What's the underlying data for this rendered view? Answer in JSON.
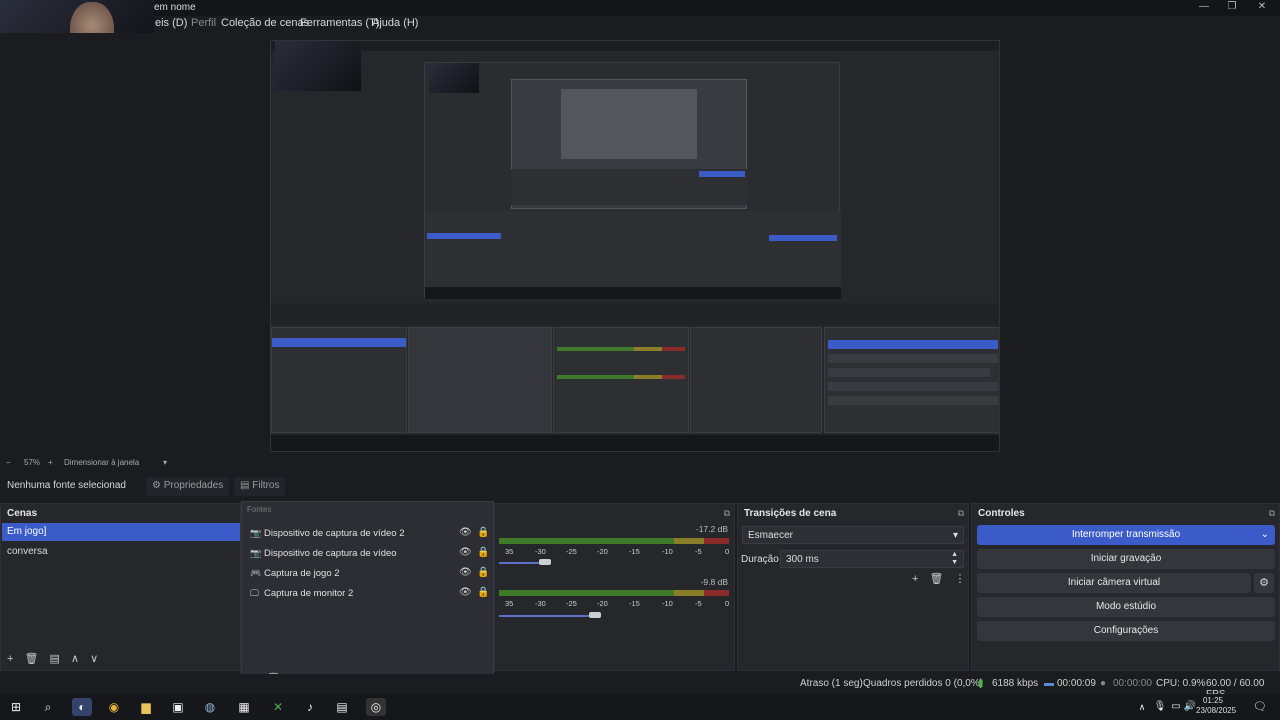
{
  "window": {
    "title": "em nome",
    "controls": [
      "—",
      "❐",
      "✕"
    ]
  },
  "menu": {
    "items": [
      {
        "label": "eis (D)",
        "dim": false
      },
      {
        "label": "Perfil",
        "dim": true
      },
      {
        "label": "Coleção de cenas",
        "dim": false
      },
      {
        "label": "Ferramentas (T)",
        "dim": false
      },
      {
        "label": "Ajuda (H)",
        "dim": false
      }
    ]
  },
  "zoom": {
    "minus": "−",
    "level": "57%",
    "plus": "+",
    "label": "Dimensionar à janela",
    "arrow": "▾"
  },
  "source_bar": {
    "no_source": "Nenhuma fonte selecionad",
    "properties": "Propriedades",
    "filters": "Filtros"
  },
  "scenes": {
    "title": "Cenas",
    "items": [
      {
        "label": "Em jogo]",
        "active": true
      },
      {
        "label": "conversa",
        "active": false
      }
    ],
    "toolbar": [
      "+",
      "🗑",
      "▤",
      "∧",
      "∨"
    ]
  },
  "sources": {
    "title": "Fontes",
    "items": [
      {
        "icon": "📷",
        "label": "Dispositivo de captura de vídeo 2"
      },
      {
        "icon": "📷",
        "label": "Dispositivo de captura de vídeo"
      },
      {
        "icon": "🎮",
        "label": "Captura de jogo 2"
      },
      {
        "icon": "🖵",
        "label": "Captura de monitor 2"
      }
    ],
    "toolbar": [
      "+",
      "🗑",
      "⚙",
      "∧",
      "∨"
    ]
  },
  "mixer": {
    "channels": [
      {
        "db": "-17.2 dB",
        "level": 0.55
      },
      {
        "db": "-9.8 dB",
        "level": 0.42
      }
    ],
    "scale": [
      "35",
      "-30",
      "-25",
      "-20",
      "-15",
      "-10",
      "-5",
      "0"
    ]
  },
  "transitions": {
    "title": "Transições de cena",
    "selected": "Esmaecer",
    "duration_label": "Duração",
    "duration_value": "300 ms"
  },
  "controls": {
    "title": "Controles",
    "buttons": [
      {
        "label": "Interromper transmissão",
        "primary": true
      },
      {
        "label": "Iniciar gravação",
        "primary": false
      },
      {
        "label": "Iniciar câmera virtual",
        "primary": false
      },
      {
        "label": "Modo estúdio",
        "primary": false
      },
      {
        "label": "Configurações",
        "primary": false
      }
    ]
  },
  "status": {
    "delay": "Atraso (1 seg)",
    "dropped": "Quadros perdidos 0 (0,0%)",
    "bitrate": "6188 kbps",
    "stream_time": "00:00:09",
    "rec_time": "00:00:00",
    "cpu": "CPU: 0.9%",
    "fps": "60.00 / 60.00 FPS"
  },
  "taskbar": {
    "time": "01:25",
    "date": "23/08/2025"
  },
  "colors": {
    "accent": "#3a5bc8",
    "background": "#1b1c1f",
    "panel": "#26272b"
  }
}
